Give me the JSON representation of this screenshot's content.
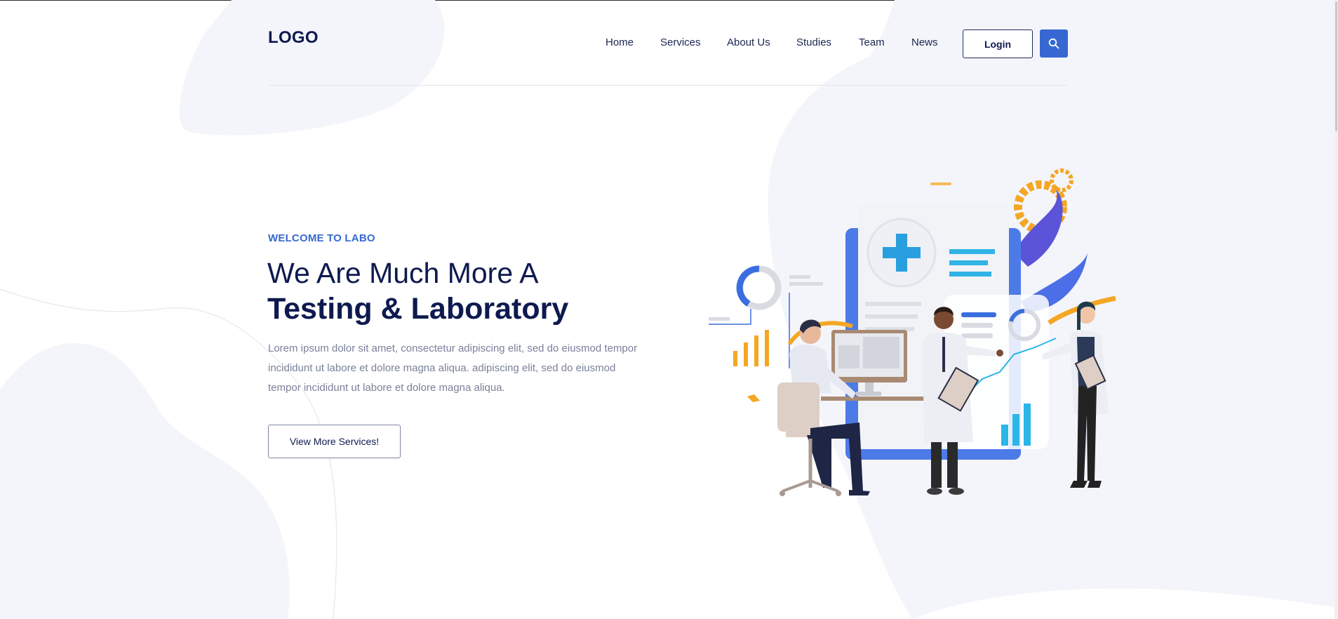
{
  "header": {
    "logo": "LOGO",
    "nav": [
      {
        "label": "Home"
      },
      {
        "label": "Services"
      },
      {
        "label": "About Us"
      },
      {
        "label": "Studies"
      },
      {
        "label": "Team"
      },
      {
        "label": "News"
      }
    ],
    "login_label": "Login",
    "search_icon": "search-icon"
  },
  "hero": {
    "eyebrow": "WELCOME TO LABO",
    "title_line1": "We Are Much More A",
    "title_line2": "Testing & Laboratory",
    "description": "Lorem ipsum dolor sit amet, consectetur adipiscing elit, sed do eiusmod tempor incididunt ut labore et dolore magna aliqua. adipiscing elit, sed do eiusmod tempor incididunt ut labore et dolore magna aliqua.",
    "cta_label": "View More Services!"
  },
  "colors": {
    "primary": "#3768d1",
    "navy": "#0e1a4f",
    "blob": "#f4f5fb",
    "accent_orange": "#f5a623",
    "accent_cyan": "#2bb6e8"
  }
}
